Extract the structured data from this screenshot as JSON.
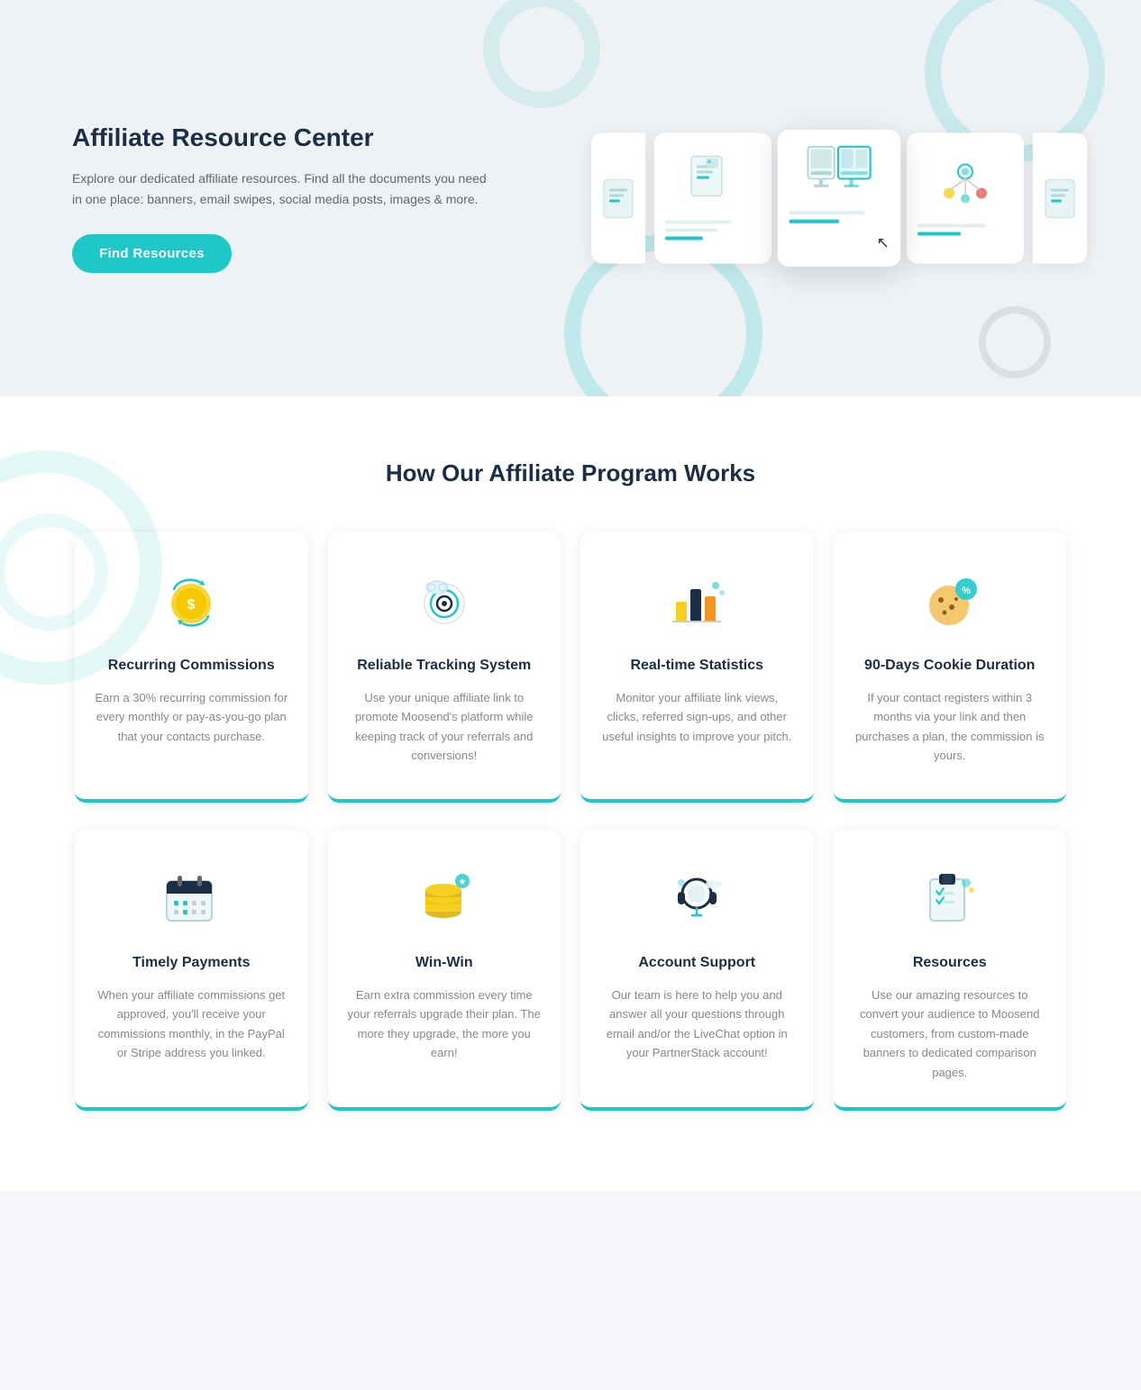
{
  "hero": {
    "title": "Affiliate Resource Center",
    "description": "Explore our dedicated affiliate resources. Find all the documents you need in one place: banners, email swipes, social media posts, images & more.",
    "button_label": "Find Resources"
  },
  "section2": {
    "title": "How Our Affiliate Program Works",
    "cards_row1": [
      {
        "id": "recurring",
        "icon": "recurring-commissions-icon",
        "title": "Recurring Commissions",
        "description": "Earn a 30% recurring commission for every monthly or pay-as-you-go plan that your contacts purchase."
      },
      {
        "id": "tracking",
        "icon": "tracking-system-icon",
        "title": "Reliable Tracking System",
        "description": "Use your unique affiliate link to promote Moosend's platform while keeping track of your referrals and conversions!"
      },
      {
        "id": "statistics",
        "icon": "statistics-icon",
        "title": "Real-time Statistics",
        "description": "Monitor your affiliate link views, clicks, referred sign-ups, and other useful insights to improve your pitch."
      },
      {
        "id": "cookie",
        "icon": "cookie-icon",
        "title": "90-Days Cookie Duration",
        "description": "If your contact registers within 3 months via your link and then purchases a plan, the commission is yours."
      }
    ],
    "cards_row2": [
      {
        "id": "payments",
        "icon": "payments-icon",
        "title": "Timely Payments",
        "description": "When your affiliate commissions get approved, you'll receive your commissions monthly, in the PayPal or Stripe address you linked."
      },
      {
        "id": "winwin",
        "icon": "winwin-icon",
        "title": "Win-Win",
        "description": "Earn extra commission every time your referrals upgrade their plan. The more they upgrade, the more you earn!"
      },
      {
        "id": "support",
        "icon": "support-icon",
        "title": "Account Support",
        "description": "Our team is here to help you and answer all your questions through email and/or the LiveChat option in your PartnerStack account!"
      },
      {
        "id": "resources",
        "icon": "resources-icon",
        "title": "Resources",
        "description": "Use our amazing resources to convert your audience to Moosend customers, from custom-made banners to dedicated comparison pages."
      }
    ]
  }
}
